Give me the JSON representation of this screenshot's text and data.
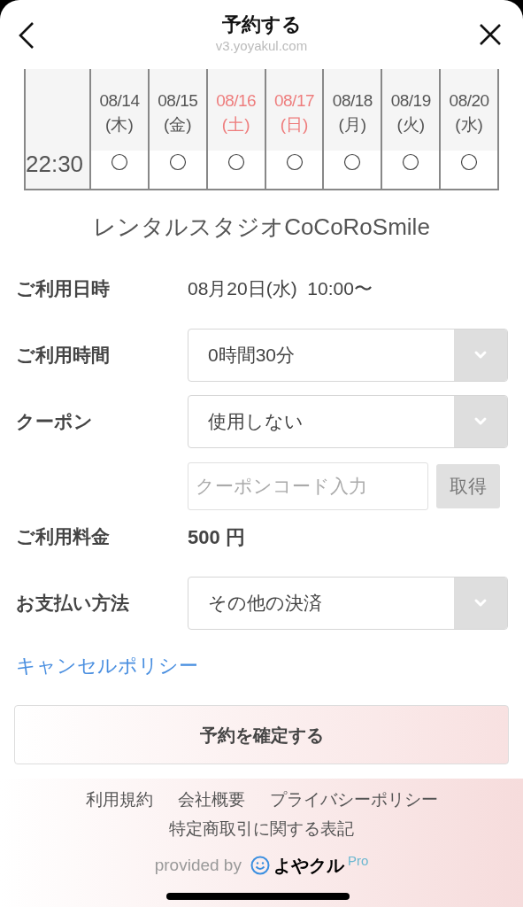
{
  "header": {
    "title": "予約する",
    "url": "v3.yoyakul.com"
  },
  "schedule": {
    "time": "22:30",
    "days": [
      {
        "date": "08/14",
        "weekday": "(木)",
        "color": "#555555"
      },
      {
        "date": "08/15",
        "weekday": "(金)",
        "color": "#555555"
      },
      {
        "date": "08/16",
        "weekday": "(土)",
        "color": "#ee7d7d"
      },
      {
        "date": "08/17",
        "weekday": "(日)",
        "color": "#ee7d7d"
      },
      {
        "date": "08/18",
        "weekday": "(月)",
        "color": "#555555"
      },
      {
        "date": "08/19",
        "weekday": "(火)",
        "color": "#555555"
      },
      {
        "date": "08/20",
        "weekday": "(水)",
        "color": "#555555"
      }
    ]
  },
  "studio_name": "レンタルスタジオCoCoRoSmile",
  "form": [
    {
      "kind": "text",
      "label": "ご利用日時",
      "value": "08月20日(水)  10:00〜"
    },
    {
      "kind": "select",
      "label": "ご利用時間",
      "value": "0時間30分"
    },
    {
      "kind": "select",
      "label": "クーポン",
      "value": "使用しない"
    },
    {
      "kind": "coupon",
      "placeholder": "クーポンコード入力",
      "button": "取得"
    },
    {
      "kind": "price",
      "label": "ご利用料金",
      "value": "500 円"
    },
    {
      "kind": "select",
      "label": "お支払い方法",
      "value": "その他の決済"
    }
  ],
  "cancel_policy_link": "キャンセルポリシー",
  "confirm_button": "予約を確定する",
  "footer": {
    "links": [
      "利用規約",
      "会社概要",
      "プライバシーポリシー",
      "特定商取引に関する表記"
    ],
    "provided_by": "provided by",
    "logo_text": "よやクル",
    "logo_badge": "Pro"
  }
}
